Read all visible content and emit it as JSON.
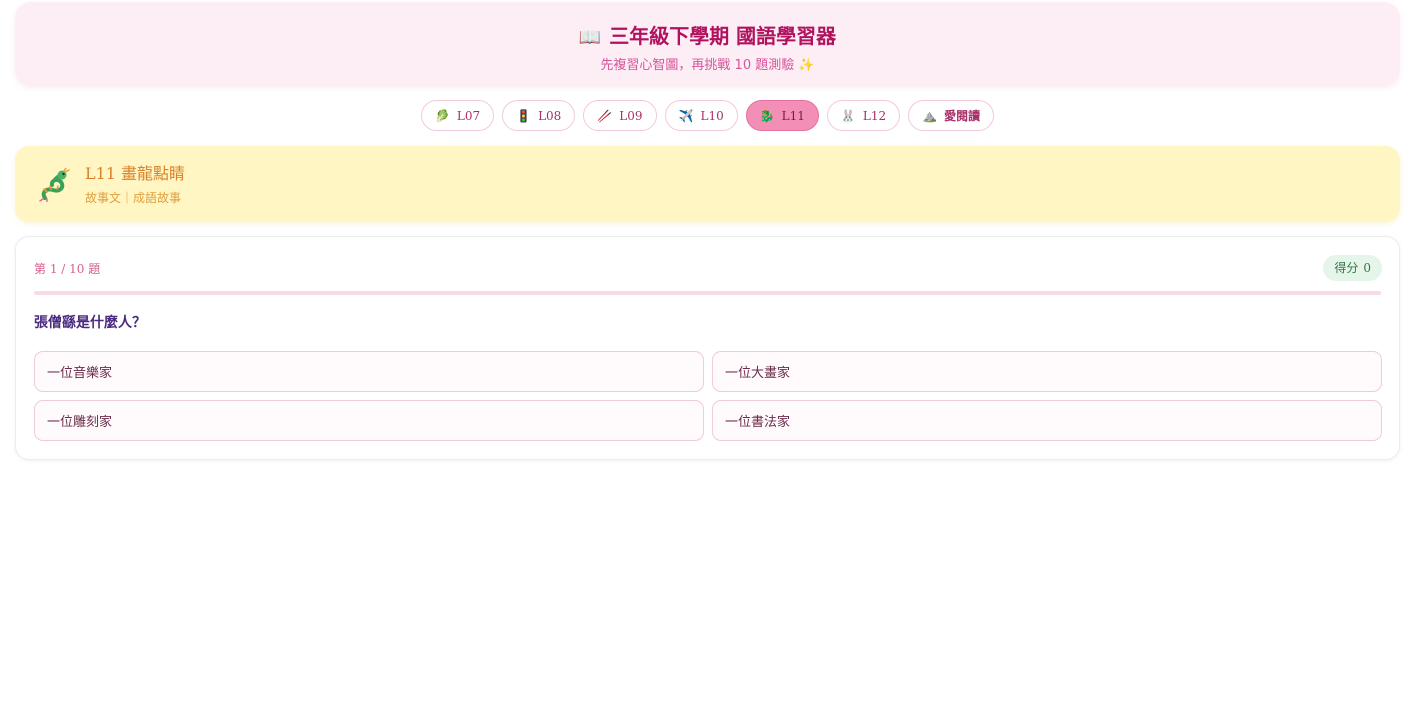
{
  "header": {
    "icon": "open-book-icon",
    "title": "三年級下學期 國語學習器",
    "subtitle": "先複習心智圖，再挑戰 10 題測驗",
    "subtitle_icon": "sparkles-icon"
  },
  "tabs": [
    {
      "label": "L07",
      "icon": "leaf-icon",
      "active": false
    },
    {
      "label": "L08",
      "icon": "traffic-light-icon",
      "active": false
    },
    {
      "label": "L09",
      "icon": "chopsticks-icon",
      "active": false
    },
    {
      "label": "L10",
      "icon": "airplane-icon",
      "active": false
    },
    {
      "label": "L11",
      "icon": "dragon-icon",
      "active": true
    },
    {
      "label": "L12",
      "icon": "rabbit-icon",
      "active": false
    },
    {
      "label": "愛閱讀",
      "icon": "mountain-icon",
      "active": false
    }
  ],
  "lesson": {
    "icon": "dragon-icon",
    "code": "L11",
    "title": "畫龍點睛",
    "meta": "故事文｜成語故事"
  },
  "quiz": {
    "progress_label": "第 1 / 10 題",
    "current": 1,
    "total": 10,
    "progress_fraction": 0.0,
    "score_label": "得分",
    "score": "0",
    "question": "張僧繇是什麼人？",
    "options": [
      {
        "label": "一位音樂家"
      },
      {
        "label": "一位大畫家"
      },
      {
        "label": "一位雕刻家"
      },
      {
        "label": "一位書法家"
      }
    ]
  },
  "colors": {
    "accent_pink": "#f38fb6",
    "title_magenta": "#b0125e",
    "lesson_bg": "#fff6c4",
    "score_green": "#2f7a45"
  }
}
